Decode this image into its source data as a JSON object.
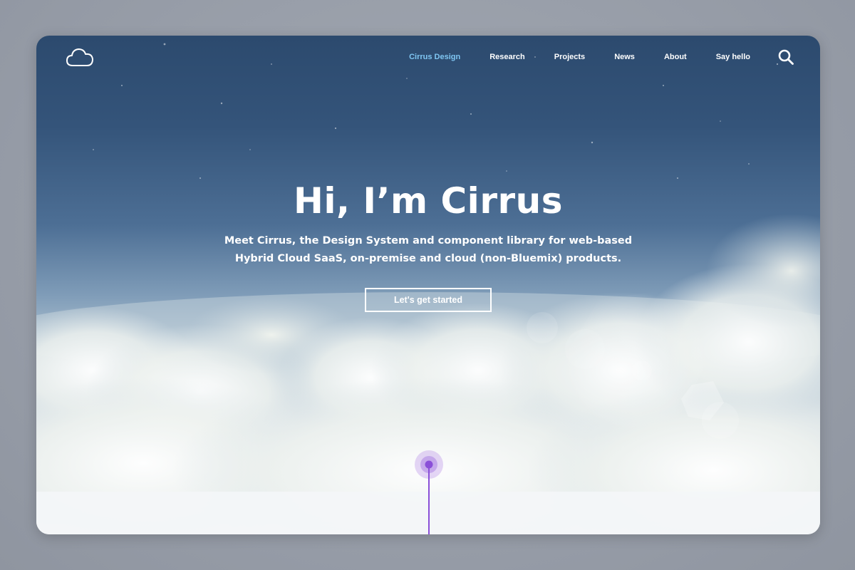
{
  "header": {
    "logo_icon": "cloud-icon",
    "nav": [
      {
        "label": "Cirrus Design",
        "active": true
      },
      {
        "label": "Research",
        "active": false
      },
      {
        "label": "Projects",
        "active": false
      },
      {
        "label": "News",
        "active": false
      },
      {
        "label": "About",
        "active": false
      },
      {
        "label": "Say hello",
        "active": false
      }
    ],
    "search_icon": "search-icon"
  },
  "hero": {
    "title": "Hi, I’m Cirrus",
    "subtitle_line1": "Meet Cirrus, the Design System and component library for web-based",
    "subtitle_line2": "Hybrid Cloud SaaS, on-premise and cloud (non-Bluemix) products.",
    "cta_label": "Let's get started"
  },
  "scroll_indicator_icon": "scroll-indicator-icon",
  "colors": {
    "active_nav": "#7fc6f2",
    "accent_purple": "#8a4fd8",
    "text": "#ffffff"
  }
}
